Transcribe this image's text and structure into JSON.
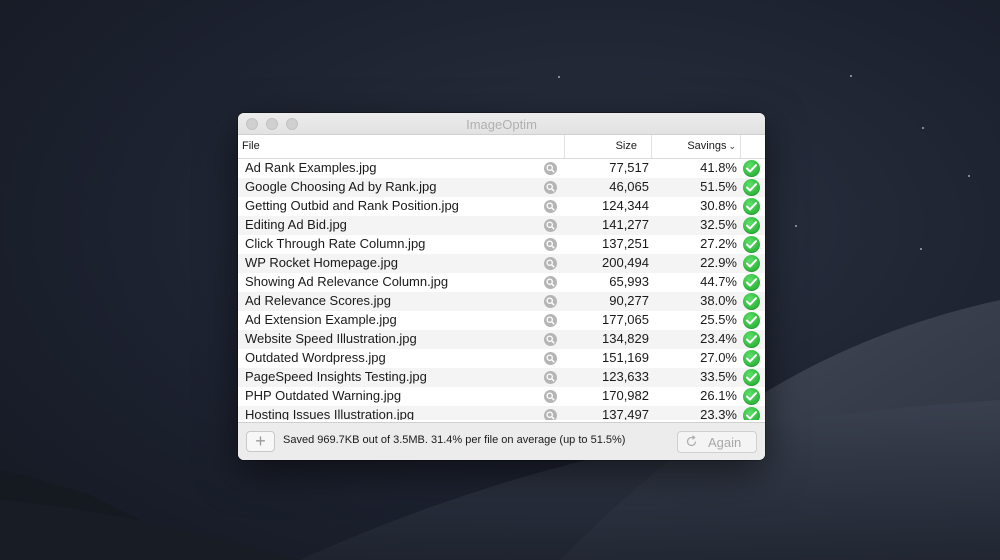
{
  "window": {
    "title": "ImageOptim"
  },
  "columns": {
    "file": "File",
    "size": "Size",
    "savings": "Savings"
  },
  "files": [
    {
      "name": "Ad Rank Examples.jpg",
      "size": "77,517",
      "savings": "41.8%"
    },
    {
      "name": "Google Choosing Ad by Rank.jpg",
      "size": "46,065",
      "savings": "51.5%"
    },
    {
      "name": "Getting Outbid and Rank Position.jpg",
      "size": "124,344",
      "savings": "30.8%"
    },
    {
      "name": "Editing Ad Bid.jpg",
      "size": "141,277",
      "savings": "32.5%"
    },
    {
      "name": "Click Through Rate Column.jpg",
      "size": "137,251",
      "savings": "27.2%"
    },
    {
      "name": "WP Rocket Homepage.jpg",
      "size": "200,494",
      "savings": "22.9%"
    },
    {
      "name": "Showing Ad Relevance Column.jpg",
      "size": "65,993",
      "savings": "44.7%"
    },
    {
      "name": "Ad Relevance Scores.jpg",
      "size": "90,277",
      "savings": "38.0%"
    },
    {
      "name": "Ad Extension Example.jpg",
      "size": "177,065",
      "savings": "25.5%"
    },
    {
      "name": "Website Speed Illustration.jpg",
      "size": "134,829",
      "savings": "23.4%"
    },
    {
      "name": "Outdated Wordpress.jpg",
      "size": "151,169",
      "savings": "27.0%"
    },
    {
      "name": "PageSpeed Insights Testing.jpg",
      "size": "123,633",
      "savings": "33.5%"
    },
    {
      "name": "PHP Outdated Warning.jpg",
      "size": "170,982",
      "savings": "26.1%"
    },
    {
      "name": "Hosting Issues Illustration.jpg",
      "size": "137,497",
      "savings": "23.3%"
    }
  ],
  "footer": {
    "add_label": "+",
    "summary": "Saved 969.7KB out of 3.5MB. 31.4% per file on average (up to 51.5%)",
    "again_label": "Again"
  },
  "icons": {
    "row_action": "magnifier-icon",
    "row_status": "checkmark-icon",
    "again": "refresh-icon",
    "sort": "chevron-down-icon"
  },
  "colors": {
    "status_ok": "#2db53a",
    "row_alt": "#f4f4f5"
  }
}
